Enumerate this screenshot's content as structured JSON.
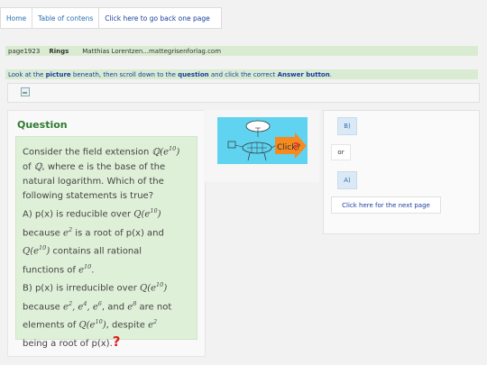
{
  "nav": {
    "home": "Home",
    "toc": "Table of contens",
    "back": "Click here to go back one page"
  },
  "meta": {
    "page": "page1923",
    "topic": "Rings",
    "author": "Matthias Lorentzen...mattegrisenforlag.com"
  },
  "instruction": {
    "t1": "Look at the ",
    "b1": "picture",
    "t2": " beneath, then scroll down to the ",
    "b2": "question",
    "t3": " and click the correct ",
    "b3": "Answer button",
    "t4": "."
  },
  "question": {
    "title": "Question",
    "l1a": "Consider the field extension ",
    "l1m": "ℚ(e",
    "l1exp": "10",
    "l1mc": ")",
    "l2a": "of ",
    "l2m": "ℚ",
    "l2b": ", where e is the base of the",
    "l3": "natural logarithm. Which of the",
    "l4": "following statements is true?",
    "l5a": "A) p(x) is reducible over ",
    "l5m": "Q(e",
    "l5exp": "10",
    "l5mc": ")",
    "l6a": "because ",
    "l6m": "e",
    "l6exp": "2",
    "l6b": " is a root of p(x) and",
    "l7m": "Q(e",
    "l7exp": "10",
    "l7mc": ")",
    "l7b": " contains all rational",
    "l8a": "functions of ",
    "l8m": "e",
    "l8exp": "10",
    "l8b": ".",
    "l9a": "B) p(x) is irreducible over ",
    "l9m": "Q(e",
    "l9exp": "10",
    "l9mc": ")",
    "l10a": "because ",
    "l10list": "e",
    "l10e1": "2",
    "l10c1": ", e",
    "l10e2": "4",
    "l10c2": ", e",
    "l10e3": "6",
    "l10and": ", and ",
    "l10m4": "e",
    "l10e4": "8",
    "l10b": " are not",
    "l11a": "elements of ",
    "l11m": "Q(e",
    "l11exp": "10",
    "l11mc": ")",
    "l11b": ", despite ",
    "l11m2": "e",
    "l11exp2": "2",
    "l12": "being a root of p(x). ",
    "qmark": "?"
  },
  "picture": {
    "click_label": "Click?",
    "click_mark": "?"
  },
  "answers": {
    "b": "B)",
    "or": "or",
    "a": "A)",
    "next": "Click here for the next page"
  },
  "colors": {
    "question_title": "#2f7a2f",
    "question_box": "#dff0d8",
    "answer_button": "#dbe9f6",
    "link": "#1a3fa0"
  }
}
